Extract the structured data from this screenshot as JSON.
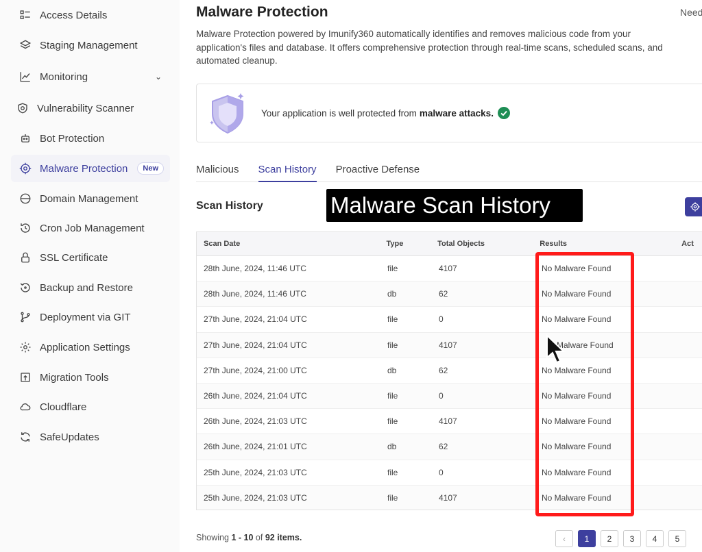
{
  "sidebar": {
    "items": [
      {
        "label": "Access Details",
        "icon": "access-details-icon"
      },
      {
        "label": "Staging Management",
        "icon": "layers-icon"
      },
      {
        "label": "Monitoring",
        "icon": "chart-line-icon"
      },
      {
        "label": "Vulnerability Scanner",
        "icon": "shield-scan-icon"
      },
      {
        "label": "Bot Protection",
        "icon": "robot-icon"
      },
      {
        "label": "Malware Protection",
        "icon": "crosshair-icon",
        "badge": "New"
      },
      {
        "label": "Domain Management",
        "icon": "globe-www-icon"
      },
      {
        "label": "Cron Job Management",
        "icon": "clock-history-icon"
      },
      {
        "label": "SSL Certificate",
        "icon": "lock-icon"
      },
      {
        "label": "Backup and Restore",
        "icon": "restore-icon"
      },
      {
        "label": "Deployment via GIT",
        "icon": "git-branch-icon"
      },
      {
        "label": "Application Settings",
        "icon": "gear-icon"
      },
      {
        "label": "Migration Tools",
        "icon": "upload-icon"
      },
      {
        "label": "Cloudflare",
        "icon": "cloud-icon"
      },
      {
        "label": "SafeUpdates",
        "icon": "refresh-icon"
      }
    ]
  },
  "header": {
    "title": "Malware Protection",
    "need_help": "Need",
    "description": "Malware Protection powered by Imunify360 automatically identifies and removes malicious code from your application's files and database. It offers comprehensive protection through real-time scans, scheduled scans, and automated cleanup."
  },
  "status_card": {
    "text": "Your application is well protected from",
    "bold": "malware attacks."
  },
  "tabs": [
    {
      "label": "Malicious"
    },
    {
      "label": "Scan History"
    },
    {
      "label": "Proactive Defense"
    }
  ],
  "section_title": "Scan History",
  "overlay_caption": "Malware Scan History",
  "table": {
    "headers": [
      "Scan Date",
      "Type",
      "Total Objects",
      "Results",
      "Act"
    ],
    "rows": [
      {
        "date": "28th June, 2024, 11:46 UTC",
        "type": "file",
        "total": "4107",
        "result": "No Malware Found"
      },
      {
        "date": "28th June, 2024, 11:46 UTC",
        "type": "db",
        "total": "62",
        "result": "No Malware Found"
      },
      {
        "date": "27th June, 2024, 21:04 UTC",
        "type": "file",
        "total": "0",
        "result": "No Malware Found"
      },
      {
        "date": "27th June, 2024, 21:04 UTC",
        "type": "file",
        "total": "4107",
        "result": "Malware Found"
      },
      {
        "date": "27th June, 2024, 21:00 UTC",
        "type": "db",
        "total": "62",
        "result": "No Malware Found"
      },
      {
        "date": "26th June, 2024, 21:04 UTC",
        "type": "file",
        "total": "0",
        "result": "No Malware Found"
      },
      {
        "date": "26th June, 2024, 21:03 UTC",
        "type": "file",
        "total": "4107",
        "result": "No Malware Found"
      },
      {
        "date": "26th June, 2024, 21:01 UTC",
        "type": "db",
        "total": "62",
        "result": "No Malware Found"
      },
      {
        "date": "25th June, 2024, 21:03 UTC",
        "type": "file",
        "total": "0",
        "result": "No Malware Found"
      },
      {
        "date": "25th June, 2024, 21:03 UTC",
        "type": "file",
        "total": "4107",
        "result": "No Malware Found"
      }
    ]
  },
  "footer": {
    "showing": "Showing",
    "range": "1 - 10",
    "of": "of",
    "total": "92 items."
  },
  "pagination": {
    "prev": "‹",
    "pages": [
      "1",
      "2",
      "3",
      "4",
      "5"
    ],
    "active": "1"
  },
  "colors": {
    "accent": "#3d3f9e",
    "highlight": "#ff1a1a",
    "success": "#1e8e55"
  }
}
